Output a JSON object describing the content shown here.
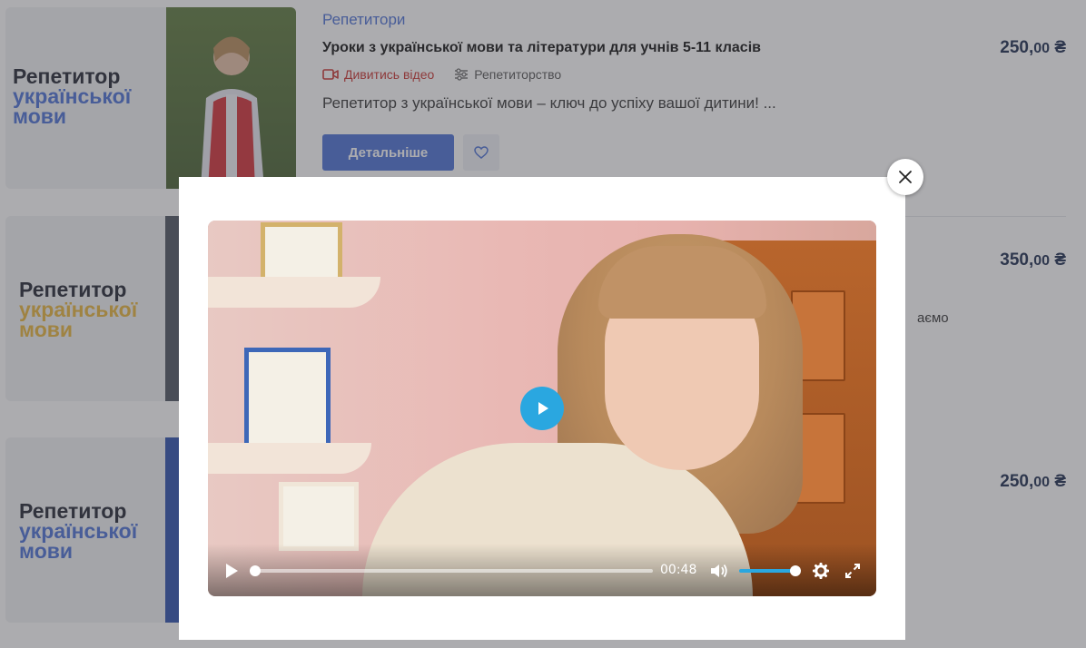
{
  "listings": [
    {
      "thumb_line1": "Репетитор",
      "thumb_line2": "української",
      "thumb_line3": "мови",
      "category": "Репетитори",
      "title": "Уроки з української мови та літератури для учнів 5-11 класів",
      "video_link": "Дивитись відео",
      "service_type": "Репетиторство",
      "description": "Репетитор з української мови – ключ до успіху вашої дитини! ...",
      "details_label": "Детальніше",
      "price_main": "250,",
      "price_cents": "00",
      "currency": "₴"
    },
    {
      "thumb_line1": "Репетитор",
      "thumb_line2": "української",
      "thumb_line3": "мови",
      "desc_peek": "аємо",
      "price_main": "350,",
      "price_cents": "00",
      "currency": "₴"
    },
    {
      "thumb_line1": "Репетитор",
      "thumb_line2": "української",
      "thumb_line3": "мови",
      "price_main": "250,",
      "price_cents": "00",
      "currency": "₴"
    }
  ],
  "video_player": {
    "current_time": "00:48",
    "progress": 0.0,
    "volume": 1.0
  },
  "colors": {
    "accent_blue": "#4a6fd6",
    "video_link_red": "#c9302c",
    "thumb_blue": "#4a6fd6",
    "thumb_yellow": "#e7b43a",
    "price_navy": "#1b2a4e",
    "player_blue": "#2aa7e0"
  }
}
